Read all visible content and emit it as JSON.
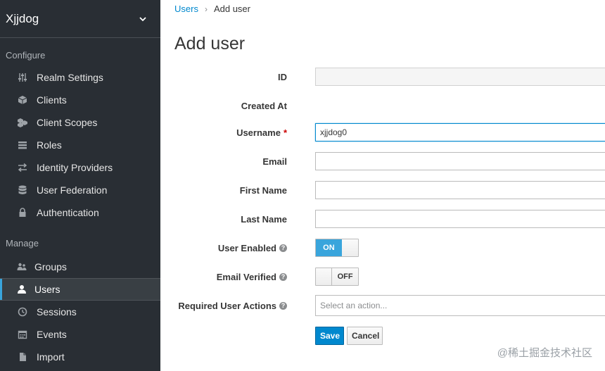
{
  "sidebar": {
    "realm": "Xjjdog",
    "configure_label": "Configure",
    "manage_label": "Manage",
    "configure_items": [
      {
        "label": "Realm Settings",
        "icon": "sliders-icon"
      },
      {
        "label": "Clients",
        "icon": "cube-icon"
      },
      {
        "label": "Client Scopes",
        "icon": "cubes-icon"
      },
      {
        "label": "Roles",
        "icon": "list-icon"
      },
      {
        "label": "Identity Providers",
        "icon": "exchange-icon"
      },
      {
        "label": "User Federation",
        "icon": "database-icon"
      },
      {
        "label": "Authentication",
        "icon": "lock-icon"
      }
    ],
    "manage_items": [
      {
        "label": "Groups",
        "icon": "users-icon"
      },
      {
        "label": "Users",
        "icon": "user-icon",
        "active": true
      },
      {
        "label": "Sessions",
        "icon": "clock-icon"
      },
      {
        "label": "Events",
        "icon": "calendar-icon"
      },
      {
        "label": "Import",
        "icon": "import-icon"
      }
    ]
  },
  "breadcrumb": {
    "link": "Users",
    "separator": "›",
    "current": "Add user"
  },
  "page": {
    "title": "Add user"
  },
  "form": {
    "id_label": "ID",
    "id_value": "",
    "created_label": "Created At",
    "username_label": "Username",
    "required_mark": "*",
    "username_value": "xjjdog0",
    "email_label": "Email",
    "email_value": "",
    "first_name_label": "First Name",
    "first_name_value": "",
    "last_name_label": "Last Name",
    "last_name_value": "",
    "user_enabled_label": "User Enabled",
    "user_enabled_state": "ON",
    "email_verified_label": "Email Verified",
    "email_verified_state": "OFF",
    "required_actions_label": "Required User Actions",
    "required_actions_placeholder": "Select an action...",
    "help_glyph": "?"
  },
  "buttons": {
    "save": "Save",
    "cancel": "Cancel"
  },
  "watermark": "@稀土掘金技术社区",
  "colors": {
    "sidebar_bg": "#292e34",
    "accent": "#0088ce",
    "toggle_on": "#39a5dc"
  }
}
